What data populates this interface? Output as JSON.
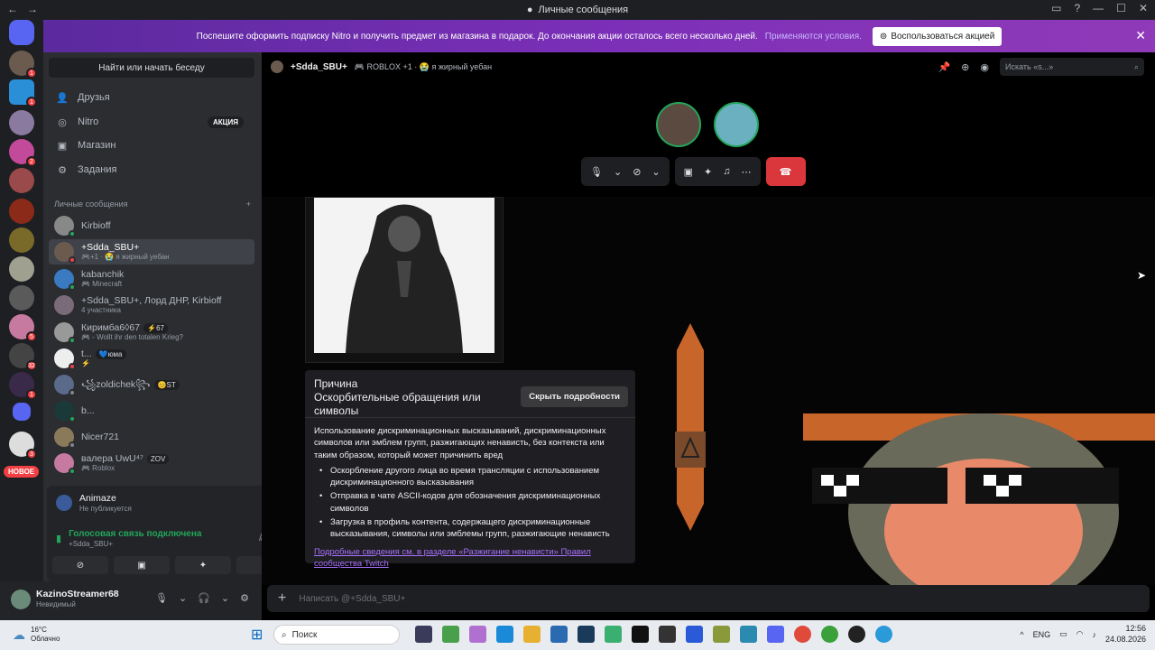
{
  "titlebar": {
    "title": "Личные сообщения"
  },
  "banner": {
    "text": "Поспешите оформить подписку Nitro и получить предмет из магазина в подарок. До окончания акции осталось всего несколько дней.",
    "link": "Применяются условия.",
    "button": "Воспользоваться акцией"
  },
  "servers": {
    "new_label": "НОВОЕ",
    "badges": [
      "1",
      "2",
      "5",
      "32",
      "1",
      "3"
    ]
  },
  "sidebar": {
    "search": "Найти или начать беседу",
    "nav": [
      {
        "label": "Друзья",
        "icon": "friends-icon"
      },
      {
        "label": "Nitro",
        "icon": "nitro-icon",
        "badge": "АКЦИЯ"
      },
      {
        "label": "Магазин",
        "icon": "shop-icon"
      },
      {
        "label": "Задания",
        "icon": "quests-icon"
      }
    ],
    "dm_header": "Личные сообщения",
    "dms": [
      {
        "name": "Kirbioff",
        "sub": ""
      },
      {
        "name": "+Sdda_SBU+",
        "sub": "🎮+1 · 😭 я жирный уебан"
      },
      {
        "name": "kabanchik",
        "sub": "🎮 Minecraft"
      },
      {
        "name": "+Sdda_SBU+, Лорд ДНР, Kirbioff",
        "sub": "4 участника"
      },
      {
        "name": "Киримба6◊67",
        "tag": "⚡67",
        "sub": "🎮 - Wollt ihr den totalen Krieg?"
      },
      {
        "name": "t...",
        "tag": "💙юма",
        "sub": "⚡"
      },
      {
        "name": "꧁zoldichek꧂",
        "tag": "😊ST",
        "sub": ""
      },
      {
        "name": "b...",
        "sub": ""
      },
      {
        "name": "Nicer721",
        "sub": ""
      },
      {
        "name": "валера UwU⁴⁷",
        "tag": "ZOV",
        "sub": "🎮 Roblox"
      }
    ]
  },
  "voice": {
    "app": "Animaze",
    "app_status": "Не публикуется",
    "connected": "Голосовая связь подключена",
    "channel": "+Sdda_SBU+"
  },
  "user": {
    "name": "KazinoStreamer68",
    "status": "Невидимый"
  },
  "channel": {
    "name": "+Sdda_SBU+",
    "activity": "🎮 ROBLOX +1 · 😭 я жирный уебан",
    "search_placeholder": "Искать «s...»"
  },
  "reason": {
    "title": "Причина",
    "heading": "Оскорбительные обращения или символы",
    "hide_button": "Скрыть подробности",
    "description": "Использование дискриминационных высказываний, дискриминационных символов или эмблем групп, разжигающих ненависть, без контекста или таким образом, который может причинить вред",
    "items": [
      "Оскорбление другого лица во время трансляции с использованием дискриминационного высказывания",
      "Отправка в чате ASCII-кодов для обозначения дискриминационных символов",
      "Загрузка в профиль контента, содержащего дискриминационные высказывания, символы или эмблемы групп, разжигающие ненависть"
    ],
    "link": "Подробные сведения см. в разделе «Разжигание ненависти» Правил сообщества Twitch"
  },
  "composer": {
    "placeholder": "Написать @+Sdda_SBU+"
  },
  "taskbar": {
    "temp": "16°C",
    "weather": "Облачно",
    "search": "Поиск",
    "lang": "ENG",
    "time": "12:56",
    "date": "24.08.2026"
  },
  "colors": {
    "accent": "#5865f2",
    "online": "#23a55a",
    "danger": "#da373c",
    "twitch": "#a970ff"
  }
}
